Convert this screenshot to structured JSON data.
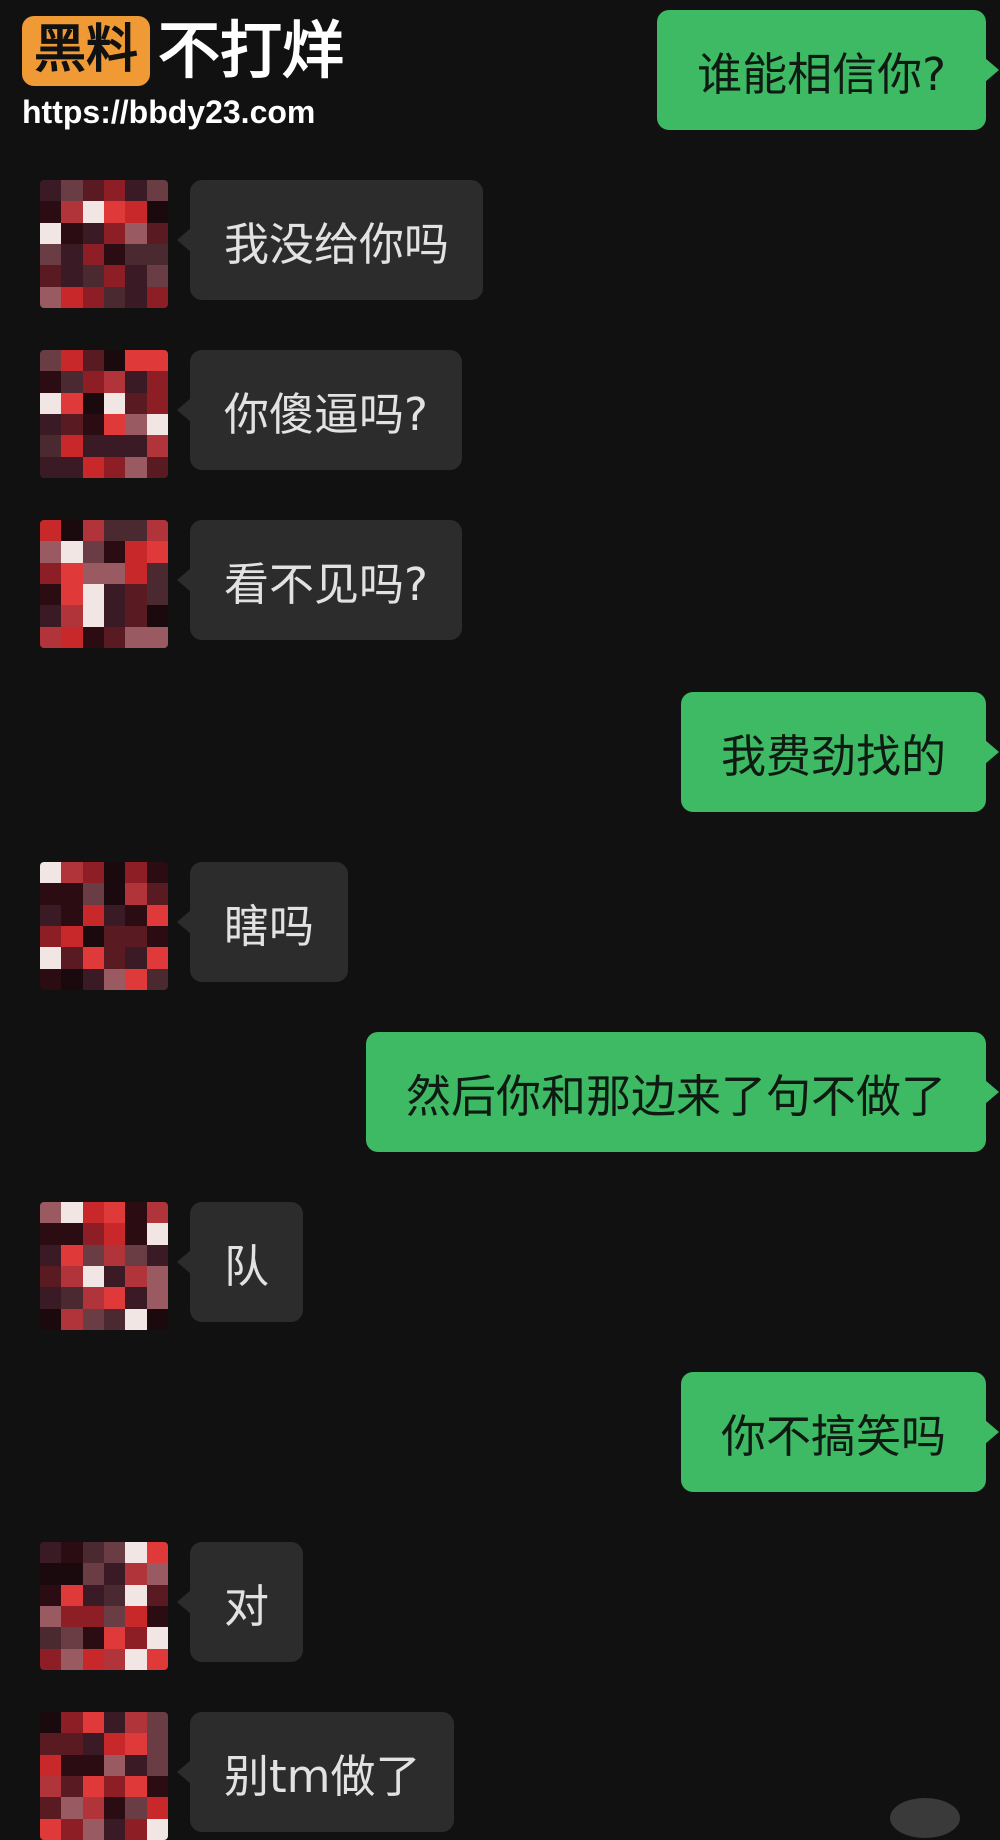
{
  "watermark": {
    "badge": "黑料",
    "tagline": "不打烊",
    "url": "https://bbdy23.com"
  },
  "colors": {
    "background": "#111111",
    "incoming_bubble": "#2c2c2c",
    "outgoing_bubble": "#3eb964",
    "watermark_badge": "#f09a35"
  },
  "messages": [
    {
      "side": "outgoing",
      "text": "谁能相信你?"
    },
    {
      "side": "incoming",
      "text": "我没给你吗",
      "avatar": "blurred-avatar"
    },
    {
      "side": "incoming",
      "text": "你傻逼吗?",
      "avatar": "blurred-avatar"
    },
    {
      "side": "incoming",
      "text": "看不见吗?",
      "avatar": "blurred-avatar"
    },
    {
      "side": "outgoing",
      "text": "我费劲找的"
    },
    {
      "side": "incoming",
      "text": "瞎吗",
      "avatar": "blurred-avatar"
    },
    {
      "side": "outgoing",
      "text": "然后你和那边来了句不做了"
    },
    {
      "side": "incoming",
      "text": "队",
      "avatar": "blurred-avatar"
    },
    {
      "side": "outgoing",
      "text": "你不搞笑吗"
    },
    {
      "side": "incoming",
      "text": "对",
      "avatar": "blurred-avatar"
    },
    {
      "side": "incoming",
      "text": "别tm做了",
      "avatar": "blurred-avatar"
    }
  ]
}
